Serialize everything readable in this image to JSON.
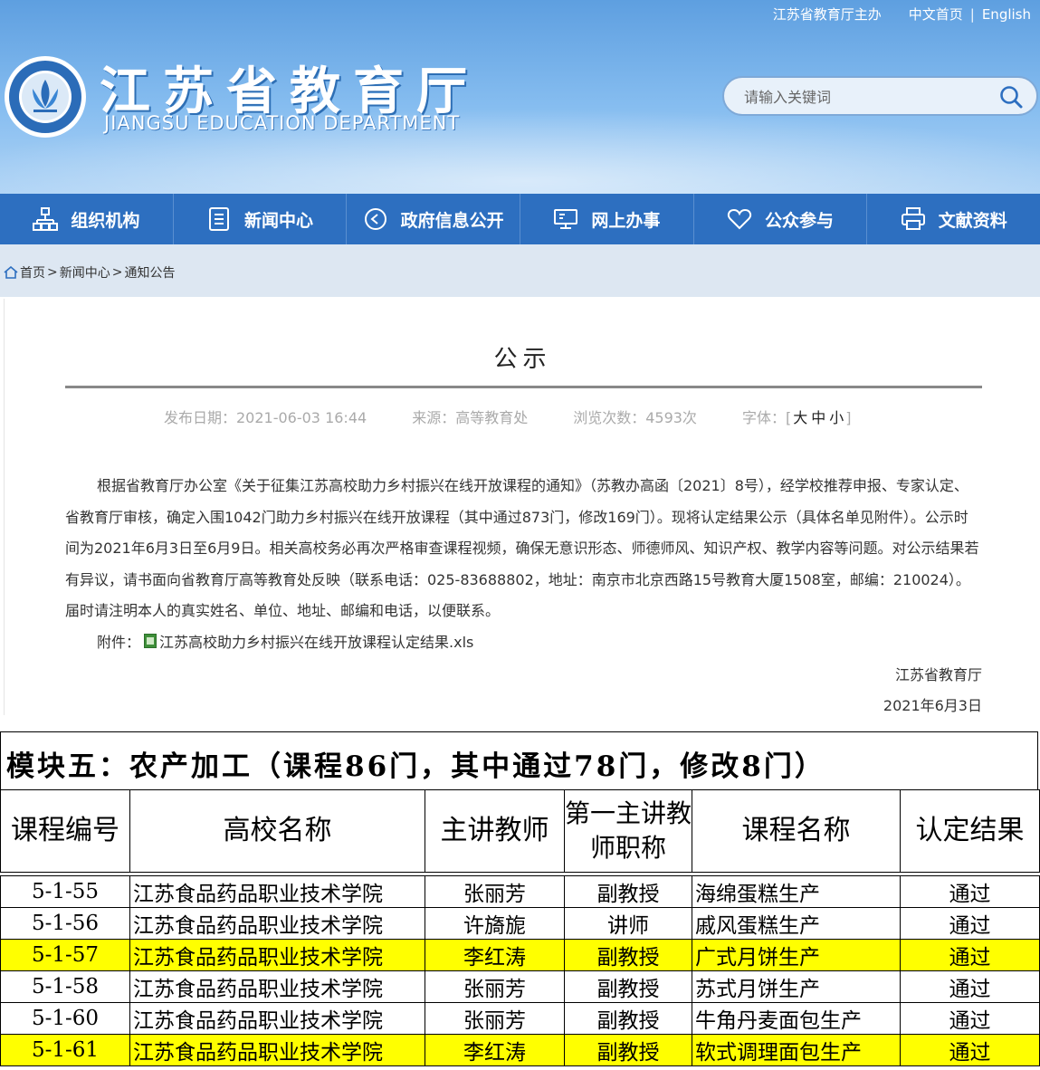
{
  "top_links": {
    "host": "江苏省教育厅主办",
    "chinese": "中文首页",
    "sep": "|",
    "english": "English"
  },
  "brand": {
    "title_cn": "江苏省教育厅",
    "title_en": "JIANGSU EDUCATION DEPARTMENT"
  },
  "search": {
    "placeholder": "请输入关键词"
  },
  "nav": [
    {
      "label": "组织机构",
      "icon": "org-chart-icon"
    },
    {
      "label": "新闻中心",
      "icon": "document-icon"
    },
    {
      "label": "政府信息公开",
      "icon": "play-circle-icon"
    },
    {
      "label": "网上办事",
      "icon": "monitor-icon"
    },
    {
      "label": "公众参与",
      "icon": "heart-icon"
    },
    {
      "label": "文献资料",
      "icon": "printer-icon"
    }
  ],
  "breadcrumb": {
    "home": "首页",
    "sep1": ">",
    "news": "新闻中心",
    "sep2": ">",
    "notice": "通知公告"
  },
  "article": {
    "title": "公示",
    "date": "发布日期：2021-06-03 16:44",
    "source": "来源：高等教育处",
    "views": "浏览次数：4593次",
    "font_label": "字体：",
    "font_open": "[",
    "font_large": "大",
    "font_medium": "中",
    "font_small": "小",
    "font_close": "]",
    "body": "根据省教育厅办公室《关于征集江苏高校助力乡村振兴在线开放课程的通知》（苏教办高函〔2021〕8号），经学校推荐申报、专家认定、省教育厅审核，确定入围1042门助力乡村振兴在线开放课程（其中通过873门，修改169门）。现将认定结果公示（具体名单见附件）。公示时间为2021年6月3日至6月9日。相关高校务必再次严格审查课程视频，确保无意识形态、师德师风、知识产权、教学内容等问题。对公示结果若有异议，请书面向省教育厅高等教育处反映（联系电话：025-83688802，地址：南京市北京西路15号教育大厦1508室，邮编：210024）。届时请注明本人的真实姓名、单位、地址、邮编和电话，以便联系。",
    "attach_label": "附件：",
    "attach_file": "江苏高校助力乡村振兴在线开放课程认定结果.xls",
    "sign_org": "江苏省教育厅",
    "sign_date": "2021年6月3日"
  },
  "sheet": {
    "module_title": "模块五：农产加工（课程86门，其中通过78门，修改8门）",
    "headers": [
      "课程编号",
      "高校名称",
      "主讲教师",
      "第一主讲教师职称",
      "课程名称",
      "认定结果"
    ],
    "rows": [
      {
        "id": "5-1-55",
        "school": "江苏食品药品职业技术学院",
        "teacher": "张丽芳",
        "rank": "副教授",
        "course": "海绵蛋糕生产",
        "result": "通过",
        "highlight": false
      },
      {
        "id": "5-1-56",
        "school": "江苏食品药品职业技术学院",
        "teacher": "许旖旎",
        "rank": "讲师",
        "course": "戚风蛋糕生产",
        "result": "通过",
        "highlight": false
      },
      {
        "id": "5-1-57",
        "school": "江苏食品药品职业技术学院",
        "teacher": "李红涛",
        "rank": "副教授",
        "course": "广式月饼生产",
        "result": "通过",
        "highlight": true
      },
      {
        "id": "5-1-58",
        "school": "江苏食品药品职业技术学院",
        "teacher": "张丽芳",
        "rank": "副教授",
        "course": "苏式月饼生产",
        "result": "通过",
        "highlight": false
      },
      {
        "id": "5-1-60",
        "school": "江苏食品药品职业技术学院",
        "teacher": "张丽芳",
        "rank": "副教授",
        "course": "牛角丹麦面包生产",
        "result": "通过",
        "highlight": false
      },
      {
        "id": "5-1-61",
        "school": "江苏食品药品职业技术学院",
        "teacher": "李红涛",
        "rank": "副教授",
        "course": "软式调理面包生产",
        "result": "通过",
        "highlight": true
      }
    ],
    "highlight_color": "#ffff00"
  },
  "colors": {
    "header_blue": "#5e9fe0",
    "nav_blue": "#2d6fc0",
    "breadcrumb_bg": "#dde7f2"
  }
}
